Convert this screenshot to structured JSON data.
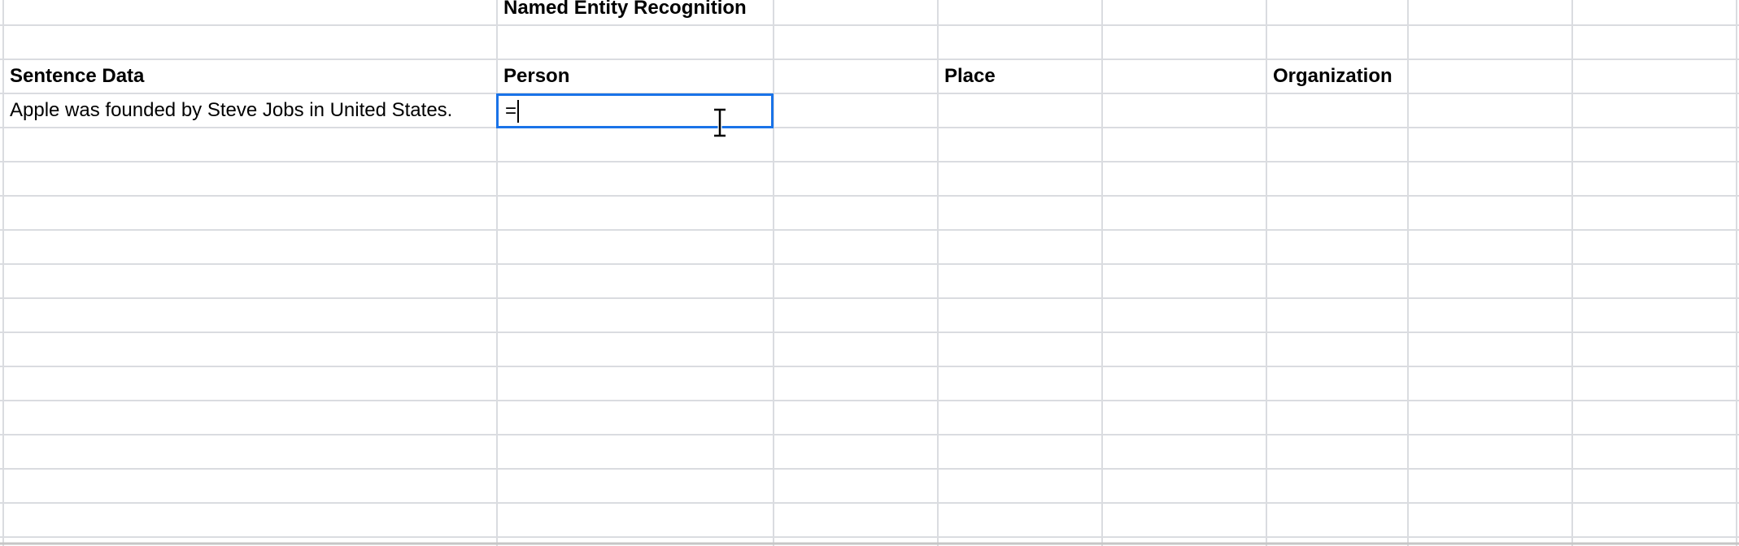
{
  "sheet": {
    "title_cell": "Named Entity Recognition",
    "headers": {
      "sentence": "Sentence Data",
      "person": "Person",
      "place": "Place",
      "organization": "Organization"
    },
    "row1": {
      "sentence": "Apple was founded by Steve Jobs in United States.",
      "person_input": "="
    }
  },
  "colors": {
    "gridline": "#dadce0",
    "selection": "#1a73e8"
  }
}
